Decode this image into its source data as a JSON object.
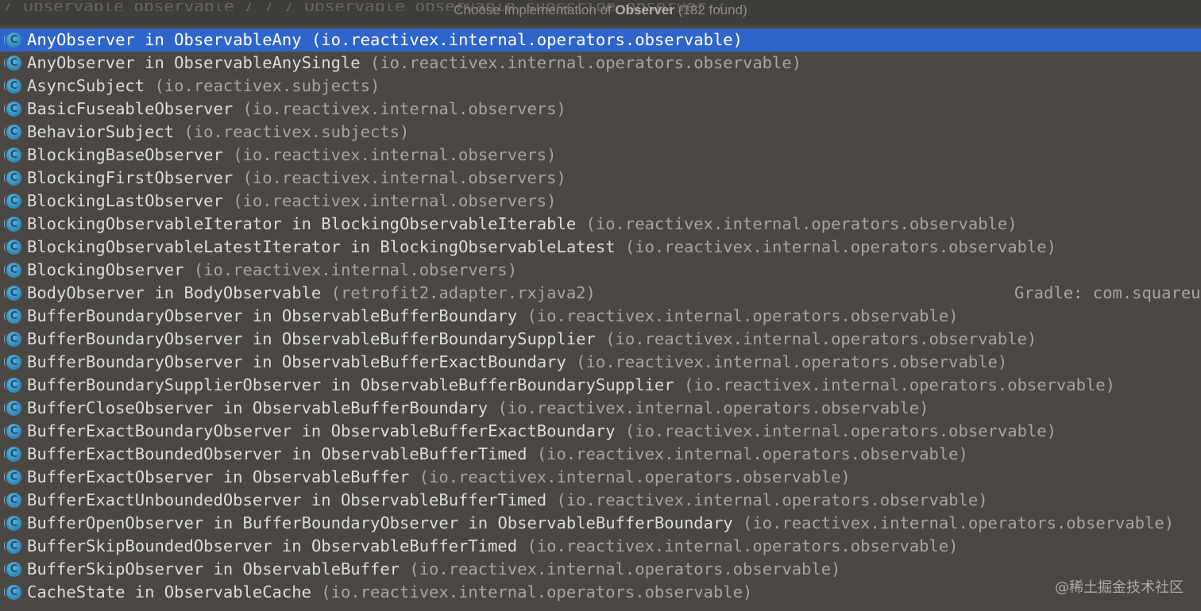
{
  "header": {
    "title_prefix": "Choose Implementation of ",
    "title_target": "Observer",
    "title_count": " (182 found)",
    "ghost_text": "/     Observable observable  /            /  /               Observable observable.subscribe    observer  /"
  },
  "list": {
    "selected_index": 0,
    "icon_letter": "C",
    "items": [
      {
        "name": "AnyObserver",
        "in": " in ",
        "outer": "ObservableAny",
        "pkg": "(io.reactivex.internal.operators.observable)"
      },
      {
        "name": "AnyObserver",
        "in": " in ",
        "outer": "ObservableAnySingle",
        "pkg": "(io.reactivex.internal.operators.observable)"
      },
      {
        "name": "AsyncSubject",
        "in": "",
        "outer": "",
        "pkg": "(io.reactivex.subjects)"
      },
      {
        "name": "BasicFuseableObserver",
        "in": "",
        "outer": "",
        "pkg": "(io.reactivex.internal.observers)"
      },
      {
        "name": "BehaviorSubject",
        "in": "",
        "outer": "",
        "pkg": "(io.reactivex.subjects)"
      },
      {
        "name": "BlockingBaseObserver",
        "in": "",
        "outer": "",
        "pkg": "(io.reactivex.internal.observers)"
      },
      {
        "name": "BlockingFirstObserver",
        "in": "",
        "outer": "",
        "pkg": "(io.reactivex.internal.observers)"
      },
      {
        "name": "BlockingLastObserver",
        "in": "",
        "outer": "",
        "pkg": "(io.reactivex.internal.observers)"
      },
      {
        "name": "BlockingObservableIterator",
        "in": " in ",
        "outer": "BlockingObservableIterable",
        "pkg": "(io.reactivex.internal.operators.observable)"
      },
      {
        "name": "BlockingObservableLatestIterator",
        "in": " in ",
        "outer": "BlockingObservableLatest",
        "pkg": "(io.reactivex.internal.operators.observable)"
      },
      {
        "name": "BlockingObserver",
        "in": "",
        "outer": "",
        "pkg": "(io.reactivex.internal.observers)"
      },
      {
        "name": "BodyObserver",
        "in": " in ",
        "outer": "BodyObservable",
        "pkg": "(retrofit2.adapter.rxjava2)",
        "lib": "Gradle: com.squareup"
      },
      {
        "name": "BufferBoundaryObserver",
        "in": " in ",
        "outer": "ObservableBufferBoundary",
        "pkg": "(io.reactivex.internal.operators.observable)"
      },
      {
        "name": "BufferBoundaryObserver",
        "in": " in ",
        "outer": "ObservableBufferBoundarySupplier",
        "pkg": "(io.reactivex.internal.operators.observable)"
      },
      {
        "name": "BufferBoundaryObserver",
        "in": " in ",
        "outer": "ObservableBufferExactBoundary",
        "pkg": "(io.reactivex.internal.operators.observable)"
      },
      {
        "name": "BufferBoundarySupplierObserver",
        "in": " in ",
        "outer": "ObservableBufferBoundarySupplier",
        "pkg": "(io.reactivex.internal.operators.observable)"
      },
      {
        "name": "BufferCloseObserver",
        "in": " in ",
        "outer": "ObservableBufferBoundary",
        "pkg": "(io.reactivex.internal.operators.observable)"
      },
      {
        "name": "BufferExactBoundaryObserver",
        "in": " in ",
        "outer": "ObservableBufferExactBoundary",
        "pkg": "(io.reactivex.internal.operators.observable)"
      },
      {
        "name": "BufferExactBoundedObserver",
        "in": " in ",
        "outer": "ObservableBufferTimed",
        "pkg": "(io.reactivex.internal.operators.observable)"
      },
      {
        "name": "BufferExactObserver",
        "in": " in ",
        "outer": "ObservableBuffer",
        "pkg": "(io.reactivex.internal.operators.observable)"
      },
      {
        "name": "BufferExactUnboundedObserver",
        "in": " in ",
        "outer": "ObservableBufferTimed",
        "pkg": "(io.reactivex.internal.operators.observable)"
      },
      {
        "name": "BufferOpenObserver",
        "in": " in ",
        "outer": "BufferBoundaryObserver in ObservableBufferBoundary",
        "pkg": "(io.reactivex.internal.operators.observable)"
      },
      {
        "name": "BufferSkipBoundedObserver",
        "in": " in ",
        "outer": "ObservableBufferTimed",
        "pkg": "(io.reactivex.internal.operators.observable)"
      },
      {
        "name": "BufferSkipObserver",
        "in": " in ",
        "outer": "ObservableBuffer",
        "pkg": "(io.reactivex.internal.operators.observable)"
      },
      {
        "name": "CacheState",
        "in": " in ",
        "outer": "ObservableCache",
        "pkg": "(io.reactivex.internal.operators.observable)"
      }
    ]
  },
  "watermark": "@稀土掘金技术社区",
  "colors": {
    "background": "#4a4743",
    "selection": "#2f65ca",
    "class_icon": "#3d9ccc"
  }
}
